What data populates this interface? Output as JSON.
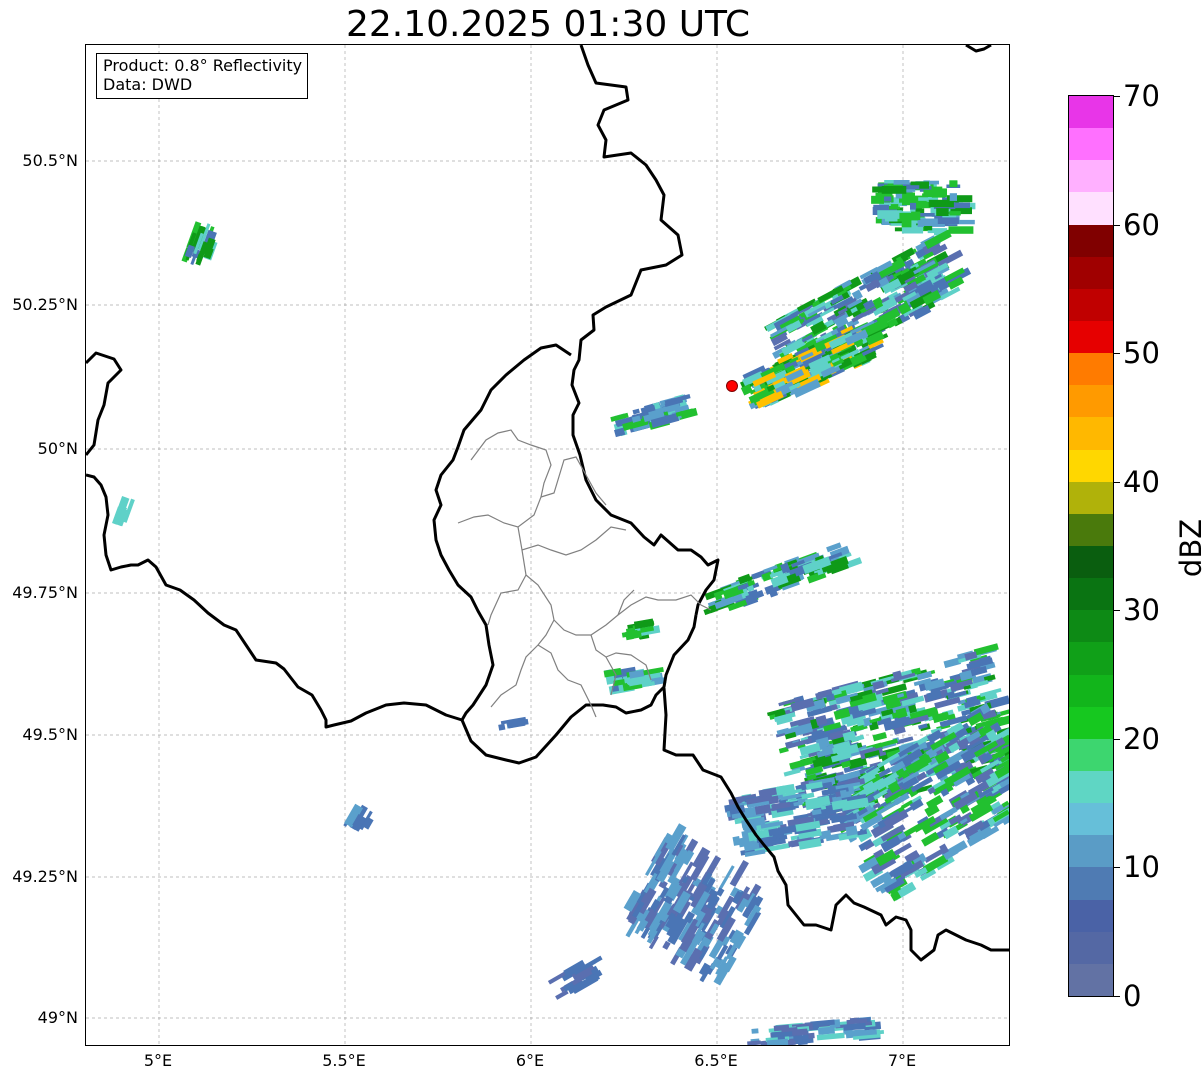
{
  "title": "22.10.2025 01:30 UTC",
  "info_box": {
    "product": "Product: 0.8° Reflectivity",
    "data": "Data: DWD"
  },
  "axes": {
    "lat_labels": [
      "50.5°N",
      "50.25°N",
      "50°N",
      "49.75°N",
      "49.5°N",
      "49.25°N",
      "49°N"
    ],
    "lon_labels": [
      "5°E",
      "5.5°E",
      "6°E",
      "6.5°E",
      "7°E"
    ]
  },
  "colorbar": {
    "unit": "dBZ",
    "tick_labels": [
      "0",
      "10",
      "20",
      "30",
      "40",
      "50",
      "60",
      "70"
    ],
    "range": [
      0,
      70
    ],
    "colors": [
      "#6272a4",
      "#5468a4",
      "#4a62a6",
      "#4f7bb3",
      "#5a9cc6",
      "#66bfd9",
      "#5fd6c4",
      "#3dd66f",
      "#16c81f",
      "#12b51b",
      "#10a018",
      "#0d8a15",
      "#0a7412",
      "#0a5e0f",
      "#4a7a0c",
      "#b0b20a",
      "#ffd700",
      "#ffb800",
      "#ff9a00",
      "#ff7b00",
      "#e60000",
      "#c00000",
      "#a00000",
      "#800000",
      "#ffe0ff",
      "#ffb0ff",
      "#ff70ff",
      "#e835e8"
    ]
  },
  "map": {
    "grid": "on",
    "site_marker_color": "#ff0000"
  }
}
